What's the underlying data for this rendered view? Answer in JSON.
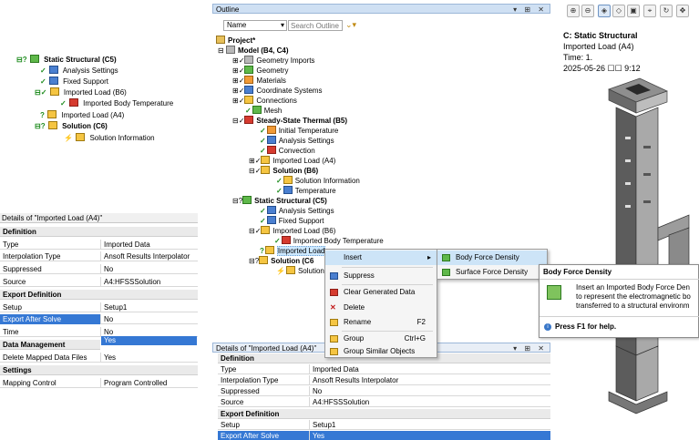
{
  "left_tree": {
    "items": [
      {
        "label": "Static Structural (C5)",
        "bold": true
      },
      {
        "label": "Analysis Settings"
      },
      {
        "label": "Fixed Support"
      },
      {
        "label": "Imported Load (B6)"
      },
      {
        "label": "Imported Body Temperature"
      },
      {
        "label": "Imported Load (A4)"
      },
      {
        "label": "Solution (C6)",
        "bold": true
      },
      {
        "label": "Solution Information"
      }
    ]
  },
  "left_details": {
    "title": "Details of \"Imported Load (A4)\"",
    "sections": [
      {
        "header": "Definition",
        "rows": [
          {
            "key": "Type",
            "value": "Imported Data"
          },
          {
            "key": "Interpolation Type",
            "value": "Ansoft Results Interpolator"
          },
          {
            "key": "Suppressed",
            "value": "No"
          },
          {
            "key": "Source",
            "value": "A4:HFSSSolution"
          }
        ]
      },
      {
        "header": "Export Definition",
        "rows": [
          {
            "key": "Setup",
            "value": "Setup1"
          },
          {
            "key": "Export After Solve",
            "value": "No"
          },
          {
            "key": "Time",
            "value": "No"
          }
        ]
      },
      {
        "header": "Data Management",
        "rows": [
          {
            "key": "Delete Mapped Data Files",
            "value": "Yes"
          }
        ]
      },
      {
        "header": "Settings",
        "rows": [
          {
            "key": "Mapping Control",
            "value": "Program Controlled"
          }
        ]
      }
    ],
    "dropdown_option": "Yes"
  },
  "outline": {
    "title": "Outline",
    "filter_label": "Name",
    "search_placeholder": "Search Outline",
    "items": [
      {
        "label": "Project*",
        "bold": true
      },
      {
        "label": "Model (B4, C4)",
        "bold": true
      },
      {
        "label": "Geometry Imports"
      },
      {
        "label": "Geometry"
      },
      {
        "label": "Materials"
      },
      {
        "label": "Coordinate Systems"
      },
      {
        "label": "Connections"
      },
      {
        "label": "Mesh"
      },
      {
        "label": "Steady-State Thermal (B5)",
        "bold": true
      },
      {
        "label": "Initial Temperature"
      },
      {
        "label": "Analysis Settings"
      },
      {
        "label": "Convection"
      },
      {
        "label": "Imported Load (A4)"
      },
      {
        "label": "Solution (B6)",
        "bold": true
      },
      {
        "label": "Solution Information"
      },
      {
        "label": "Temperature"
      },
      {
        "label": "Static Structural (C5)",
        "bold": true
      },
      {
        "label": "Analysis Settings"
      },
      {
        "label": "Fixed Support"
      },
      {
        "label": "Imported Load (B6)"
      },
      {
        "label": "Imported Body Temperature"
      },
      {
        "label": "Imported Load"
      },
      {
        "label": "Solution (C6"
      },
      {
        "label": "Solution"
      }
    ]
  },
  "context_menu": {
    "items": [
      {
        "label": "Insert",
        "shortcut": "",
        "has_submenu": true
      },
      {
        "label": "Suppress",
        "shortcut": ""
      },
      {
        "label": "Clear Generated Data",
        "shortcut": ""
      },
      {
        "label": "Delete",
        "shortcut": ""
      },
      {
        "label": "Rename",
        "shortcut": "F2"
      },
      {
        "label": "Group",
        "shortcut": "Ctrl+G"
      },
      {
        "label": "Group Similar Objects",
        "shortcut": ""
      }
    ],
    "submenu": [
      {
        "label": "Body Force Density"
      },
      {
        "label": "Surface Force Density"
      }
    ]
  },
  "tooltip": {
    "title": "Body Force Density",
    "lines": [
      "Insert an Imported Body Force Den",
      "to represent the electromagnetic bo",
      "transferred to a structural environm"
    ],
    "help": "Press F1 for help."
  },
  "lower_details": {
    "title": "Details of \"Imported Load (A4)\"",
    "sections": [
      {
        "header": "Definition",
        "rows": [
          {
            "key": "Type",
            "value": "Imported Data"
          },
          {
            "key": "Interpolation Type",
            "value": "Ansoft Results Interpolator"
          },
          {
            "key": "Suppressed",
            "value": "No"
          },
          {
            "key": "Source",
            "value": "A4:HFSSSolution"
          }
        ]
      },
      {
        "header": "Export Definition",
        "rows": [
          {
            "key": "Setup",
            "value": "Setup1"
          },
          {
            "key": "Export After Solve",
            "value": "Yes"
          }
        ]
      }
    ]
  },
  "viewer": {
    "title": "C: Static Structural",
    "subtitle": "Imported Load (A4)",
    "time": "Time: 1.",
    "date": "2025-05-26 ☐☐ 9:12"
  },
  "colors": {
    "selection": "#3578d4",
    "menu_hot": "#cde4f7",
    "pane_title": "#cfe0f3"
  }
}
